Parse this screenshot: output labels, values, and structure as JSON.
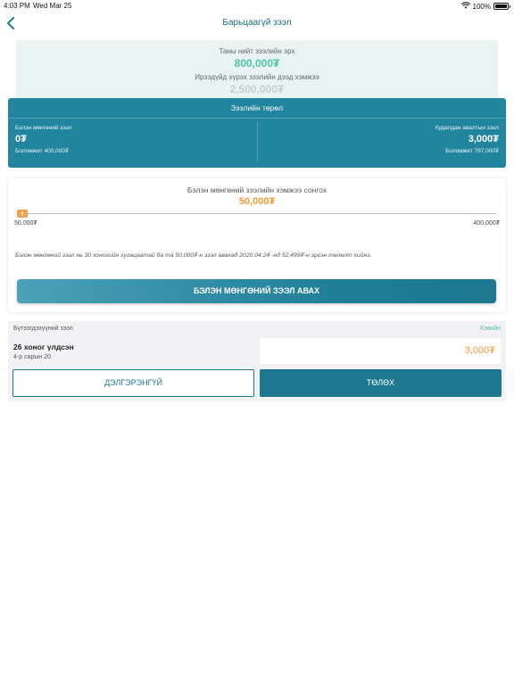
{
  "status_bar": {
    "time": "4:03 PM",
    "date": "Wed Mar 25",
    "battery": "100%"
  },
  "nav": {
    "title": "Барьцаагүй зээл",
    "back_icon": "chevron-left-icon"
  },
  "summary": {
    "total_label": "Таны нийт зээлийн эрх",
    "total_value": "800,000₮",
    "future_label": "Ирээдүйд хүрэх зээлийн дээд хэмжээ",
    "future_value": "2,500,000₮"
  },
  "loan_types": {
    "title": "Зээлийн төрөл",
    "cash": {
      "label": "Бэлэн мөнгөний зээл",
      "value": "0₮",
      "available": "Боломжит 400,000₮"
    },
    "purchase": {
      "label": "Худалдан авалтын зээл",
      "value": "3,000₮",
      "available": "Боломжит 797,000₮"
    }
  },
  "selector": {
    "title": "Бэлэн мөнгөний зээлийн хэмжээ сонгох",
    "value": "50,000₮",
    "min_label": "50,000₮",
    "max_label": "400,000₮",
    "slider_fraction": 0,
    "note": "Бэлэн мөнгөний зээл нь 30 хоногийн хугацаатай ба та 50,000₮-н зээл авахад 2020.04.24 -нд 52,499₮-н эргэн төлөлт хийнэ.",
    "button_label": "БЭЛЭН МӨНГӨНИЙ ЗЭЭЛ АВАХ"
  },
  "product": {
    "label": "Бүтээгдэхүүний зээл",
    "link": "Хэвийн",
    "days_left": "26 хоног үлдсэн",
    "date": "4-р сарын 20",
    "amount": "3,000₮",
    "detail_button": "ДЭЛГЭРЭНГҮЙ",
    "pay_button": "ТӨЛӨХ"
  },
  "colors": {
    "primary": "#1d7790",
    "accent_green": "#4ec3a7",
    "accent_orange": "#f39a35"
  }
}
